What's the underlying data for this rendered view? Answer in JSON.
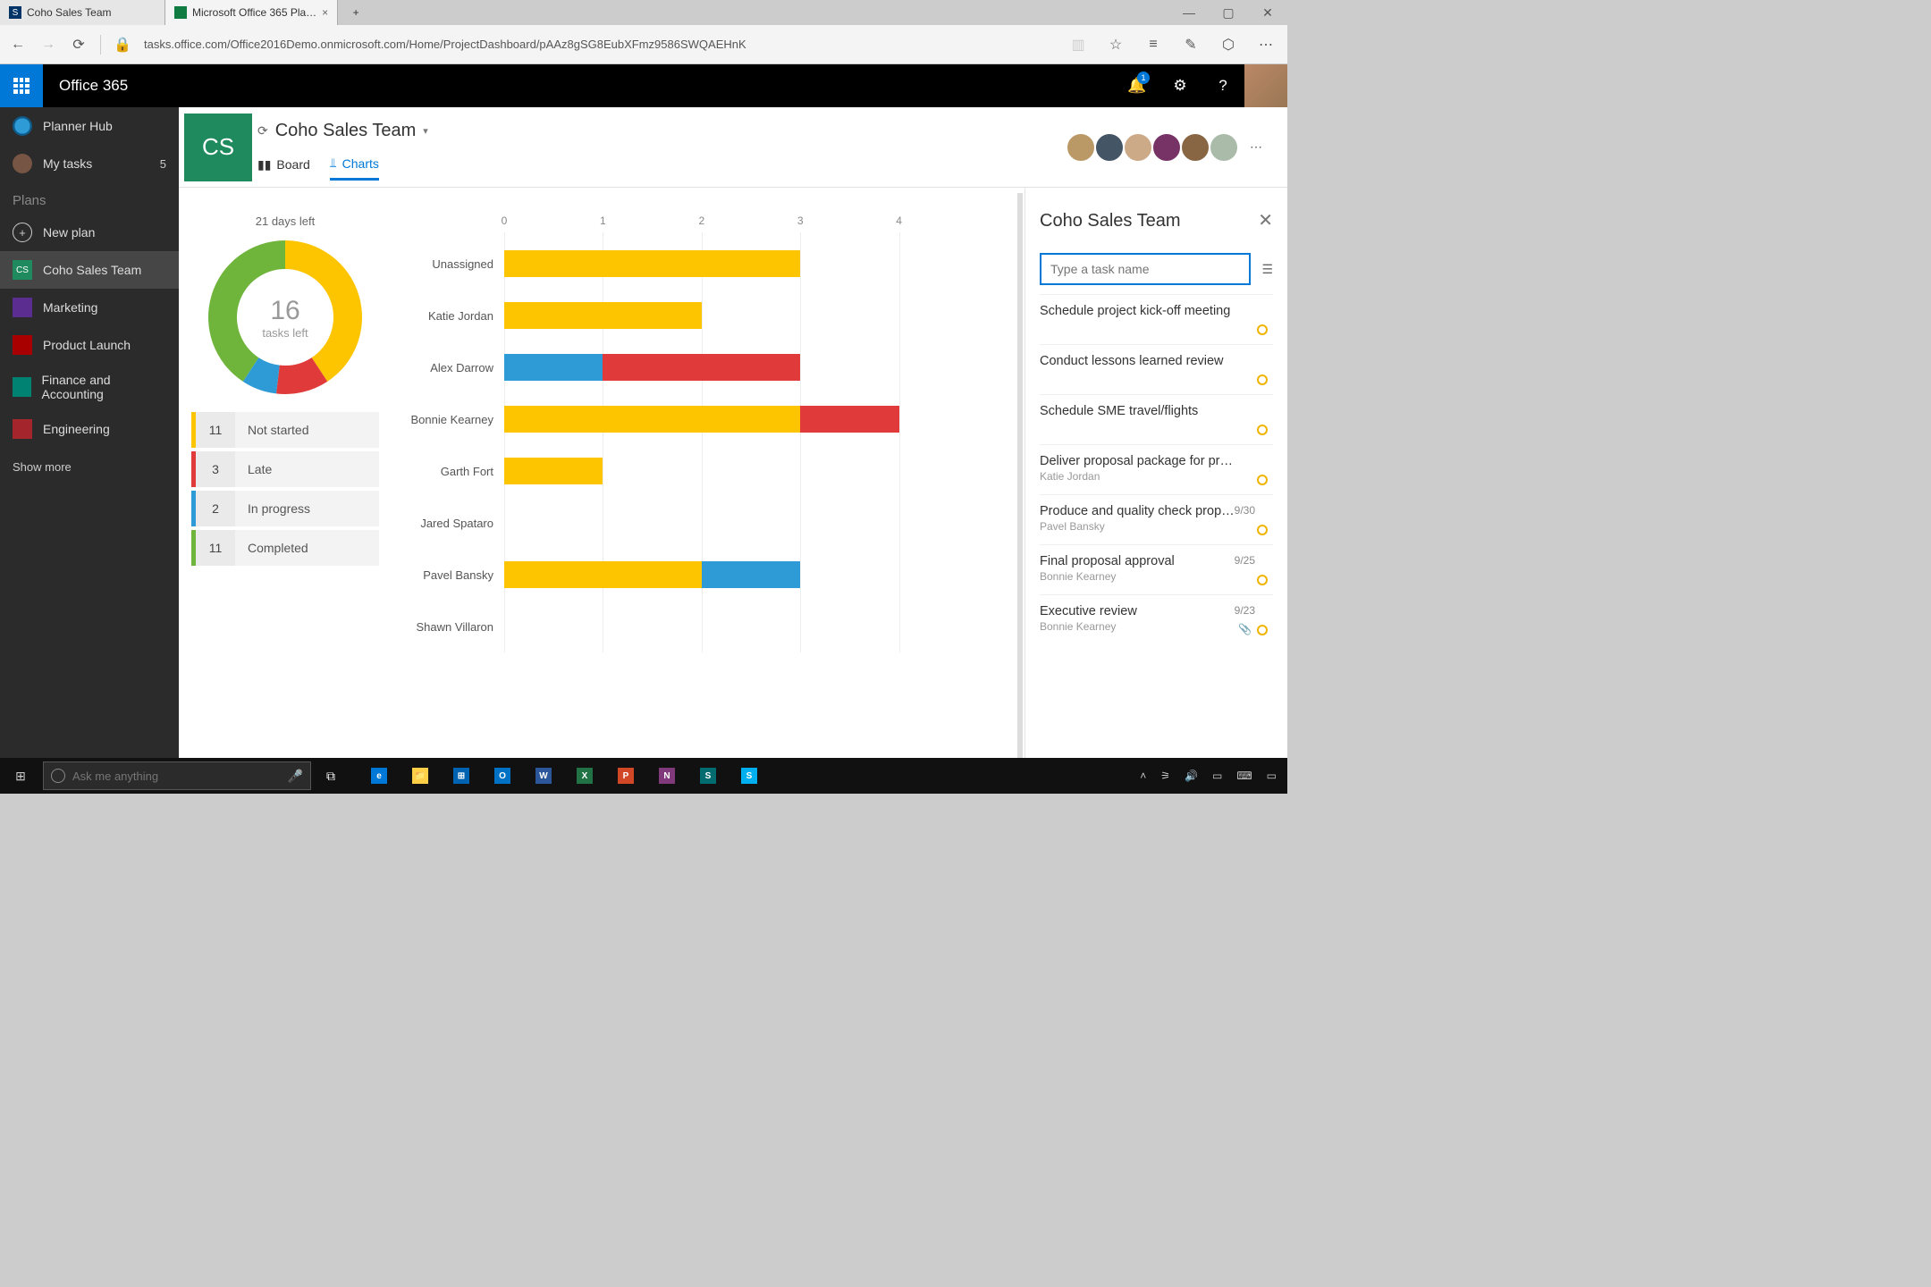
{
  "browser": {
    "tabs": [
      {
        "title": "Coho Sales Team",
        "fav_bg": "#036",
        "fav_text": "S"
      },
      {
        "title": "Microsoft Office 365 Pla…",
        "fav_bg": "#107c41",
        "fav_text": ""
      }
    ],
    "url": "tasks.office.com/Office2016Demo.onmicrosoft.com/Home/ProjectDashboard/pAAz8gSG8EubXFmz9586SWQAEHnK"
  },
  "o365": {
    "brand": "Office 365",
    "notifications": "1"
  },
  "leftnav": {
    "hub": "Planner Hub",
    "mytasks": {
      "label": "My tasks",
      "count": "5"
    },
    "section": "Plans",
    "newplan": "New plan",
    "plans": [
      {
        "label": "Coho Sales Team",
        "initials": "CS",
        "bg": "#1e8a5e",
        "active": true
      },
      {
        "label": "Marketing",
        "initials": "",
        "bg": "#5c2d91"
      },
      {
        "label": "Product Launch",
        "initials": "",
        "bg": "#a80000"
      },
      {
        "label": "Finance and Accounting",
        "initials": "",
        "bg": "#008272"
      },
      {
        "label": "Engineering",
        "initials": "",
        "bg": "#a4262c"
      }
    ],
    "showmore": "Show more"
  },
  "plan": {
    "initials": "CS",
    "title": "Coho Sales Team",
    "tabs": {
      "board": "Board",
      "charts": "Charts"
    }
  },
  "donut": {
    "days_left": "21 days left",
    "center_num": "16",
    "center_lbl": "tasks left"
  },
  "legend": [
    {
      "count": "11",
      "label": "Not started",
      "color": "#fdc400"
    },
    {
      "count": "3",
      "label": "Late",
      "color": "#e03a3a"
    },
    {
      "count": "2",
      "label": "In progress",
      "color": "#2e9bd6"
    },
    {
      "count": "11",
      "label": "Completed",
      "color": "#6fb53c"
    }
  ],
  "panel": {
    "title": "Coho Sales Team",
    "placeholder": "Type a task name",
    "tasks": [
      {
        "name": "Schedule project kick-off meeting"
      },
      {
        "name": "Conduct lessons learned review"
      },
      {
        "name": "Schedule SME travel/flights"
      },
      {
        "name": "Deliver proposal package for product",
        "assignee": "Katie Jordan"
      },
      {
        "name": "Produce and quality check proposal",
        "assignee": "Pavel Bansky",
        "date": "9/30"
      },
      {
        "name": "Final proposal approval",
        "assignee": "Bonnie Kearney",
        "date": "9/25"
      },
      {
        "name": "Executive review",
        "assignee": "Bonnie Kearney",
        "date": "9/23",
        "clip": true
      }
    ]
  },
  "taskbar": {
    "search_placeholder": "Ask me anything",
    "apps": [
      {
        "letter": "e",
        "bg": "#0078d7"
      },
      {
        "letter": "📁",
        "bg": "#ffcf48",
        "txt": "#3a2"
      },
      {
        "letter": "⊞",
        "bg": "#0063b1"
      },
      {
        "letter": "O",
        "bg": "#0072c6"
      },
      {
        "letter": "W",
        "bg": "#2b579a"
      },
      {
        "letter": "X",
        "bg": "#217346"
      },
      {
        "letter": "P",
        "bg": "#d24726"
      },
      {
        "letter": "N",
        "bg": "#80397b"
      },
      {
        "letter": "S",
        "bg": "#036c70"
      },
      {
        "letter": "S",
        "bg": "#00aff0"
      }
    ]
  },
  "chart_data": {
    "donut": {
      "type": "pie",
      "title": "Task status (16 tasks left, 21 days left)",
      "series": [
        {
          "name": "Not started",
          "value": 11,
          "color": "#fdc400"
        },
        {
          "name": "Late",
          "value": 3,
          "color": "#e03a3a"
        },
        {
          "name": "In progress",
          "value": 2,
          "color": "#2e9bd6"
        },
        {
          "name": "Completed",
          "value": 11,
          "color": "#6fb53c"
        }
      ]
    },
    "members_bar": {
      "type": "bar",
      "xlabel": "",
      "ylabel": "",
      "xlim": [
        0,
        5
      ],
      "ticks": [
        0,
        1,
        2,
        3,
        4
      ],
      "categories": [
        "Unassigned",
        "Katie Jordan",
        "Alex Darrow",
        "Bonnie Kearney",
        "Garth Fort",
        "Jared Spataro",
        "Pavel Bansky",
        "Shawn Villaron"
      ],
      "series": [
        {
          "name": "Not started",
          "color": "#fdc400",
          "values": [
            3.0,
            2.0,
            0.0,
            3.0,
            1.0,
            0.0,
            2.0,
            0.0
          ]
        },
        {
          "name": "Late",
          "color": "#e03a3a",
          "values": [
            0.0,
            0.0,
            2.0,
            1.0,
            0.0,
            0.0,
            0.0,
            0.0
          ]
        },
        {
          "name": "In progress",
          "color": "#2e9bd6",
          "values": [
            0.0,
            0.0,
            1.0,
            0.0,
            0.0,
            0.0,
            1.0,
            0.0
          ]
        }
      ]
    }
  }
}
